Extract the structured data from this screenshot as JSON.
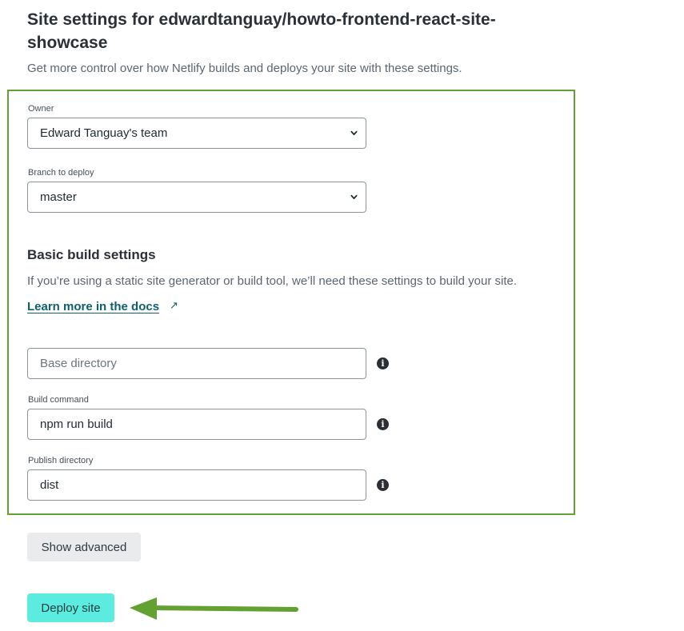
{
  "page": {
    "title": "Site settings for edwardtanguay/howto-frontend-react-site-showcase",
    "subtitle": "Get more control over how Netlify builds and deploys your site with these settings."
  },
  "owner": {
    "label": "Owner",
    "value": "Edward Tanguay's team"
  },
  "branch": {
    "label": "Branch to deploy",
    "value": "master"
  },
  "build": {
    "heading": "Basic build settings",
    "description": "If you’re using a static site generator or build tool, we’ll need these settings to build your site.",
    "docs_link": "Learn more in the docs",
    "docs_link_icon": "↗",
    "base_directory": {
      "placeholder": "Base directory",
      "value": ""
    },
    "build_command": {
      "label": "Build command",
      "value": "npm run build"
    },
    "publish_directory": {
      "label": "Publish directory",
      "value": "dist"
    },
    "info_glyph": "i"
  },
  "buttons": {
    "show_advanced": "Show advanced",
    "deploy": "Deploy site"
  },
  "colors": {
    "highlight_frame": "#63a132",
    "annotation_arrow": "#63a132",
    "deploy_button": "#5cebdf",
    "link": "#0e5f6f"
  }
}
